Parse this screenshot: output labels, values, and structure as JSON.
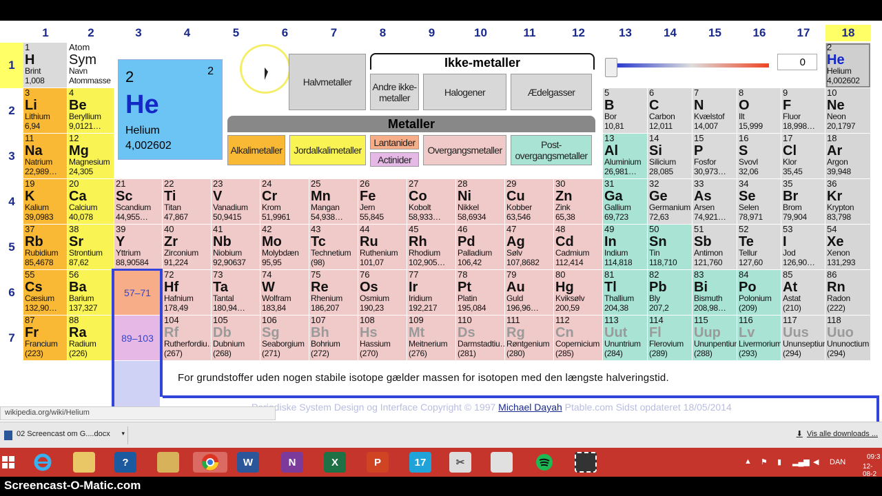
{
  "groups": [
    "1",
    "2",
    "3",
    "4",
    "5",
    "6",
    "7",
    "8",
    "9",
    "10",
    "11",
    "12",
    "13",
    "14",
    "15",
    "16",
    "17",
    "18"
  ],
  "periods": [
    "1",
    "2",
    "3",
    "4",
    "5",
    "6",
    "7"
  ],
  "legend": {
    "key": {
      "z": "Atom",
      "s": "Sym",
      "n": "Navn",
      "m": "Atommasse"
    },
    "halvmetaller": "Halvmetaller",
    "ikke_metaller": "Ikke-metaller",
    "andre": "Andre ikke-metaller",
    "halogener": "Halogener",
    "aedelgasser": "Ædelgasser",
    "metaller": "Metaller",
    "alkalimetaller": "Alkalimetaller",
    "jordalkalimetaller": "Jordalkalimetaller",
    "lantanider": "Lantanider",
    "actinider": "Actinider",
    "overgangsmetaller": "Overgangsmetaller",
    "post": "Post-overgangsmetaller"
  },
  "slider_value": "0",
  "detail": {
    "z": "2",
    "s": "He",
    "n": "Helium",
    "m": "4,002602",
    "shells": "2"
  },
  "elements": [
    {
      "z": "1",
      "s": "H",
      "n": "Brint",
      "m": "1,008",
      "c": "non",
      "r": 1,
      "g": 1
    },
    {
      "z": "2",
      "s": "He",
      "n": "Helium",
      "m": "4,002602",
      "c": "no",
      "r": 1,
      "g": 18
    },
    {
      "z": "3",
      "s": "Li",
      "n": "Lithium",
      "m": "6,94",
      "c": "alk",
      "r": 2,
      "g": 1
    },
    {
      "z": "4",
      "s": "Be",
      "n": "Beryllium",
      "m": "9,0121…",
      "c": "ear",
      "r": 2,
      "g": 2
    },
    {
      "z": "5",
      "s": "B",
      "n": "Bor",
      "m": "10,81",
      "c": "non",
      "r": 2,
      "g": 13
    },
    {
      "z": "6",
      "s": "C",
      "n": "Carbon",
      "m": "12,011",
      "c": "non",
      "r": 2,
      "g": 14
    },
    {
      "z": "7",
      "s": "N",
      "n": "Kvælstof",
      "m": "14,007",
      "c": "non",
      "r": 2,
      "g": 15
    },
    {
      "z": "8",
      "s": "O",
      "n": "Ilt",
      "m": "15,999",
      "c": "non",
      "r": 2,
      "g": 16
    },
    {
      "z": "9",
      "s": "F",
      "n": "Fluor",
      "m": "18,998…",
      "c": "non",
      "r": 2,
      "g": 17
    },
    {
      "z": "10",
      "s": "Ne",
      "n": "Neon",
      "m": "20,1797",
      "c": "no",
      "r": 2,
      "g": 18
    },
    {
      "z": "11",
      "s": "Na",
      "n": "Natrium",
      "m": "22,989…",
      "c": "alk",
      "r": 3,
      "g": 1
    },
    {
      "z": "12",
      "s": "Mg",
      "n": "Magnesium",
      "m": "24,305",
      "c": "ear",
      "r": 3,
      "g": 2
    },
    {
      "z": "13",
      "s": "Al",
      "n": "Aluminium",
      "m": "26,981…",
      "c": "pst",
      "r": 3,
      "g": 13
    },
    {
      "z": "14",
      "s": "Si",
      "n": "Silicium",
      "m": "28,085",
      "c": "non",
      "r": 3,
      "g": 14
    },
    {
      "z": "15",
      "s": "P",
      "n": "Fosfor",
      "m": "30,973…",
      "c": "non",
      "r": 3,
      "g": 15
    },
    {
      "z": "16",
      "s": "S",
      "n": "Svovl",
      "m": "32,06",
      "c": "non",
      "r": 3,
      "g": 16
    },
    {
      "z": "17",
      "s": "Cl",
      "n": "Klor",
      "m": "35,45",
      "c": "non",
      "r": 3,
      "g": 17
    },
    {
      "z": "18",
      "s": "Ar",
      "n": "Argon",
      "m": "39,948",
      "c": "no",
      "r": 3,
      "g": 18
    },
    {
      "z": "19",
      "s": "K",
      "n": "Kalium",
      "m": "39,0983",
      "c": "alk",
      "r": 4,
      "g": 1
    },
    {
      "z": "20",
      "s": "Ca",
      "n": "Calcium",
      "m": "40,078",
      "c": "ear",
      "r": 4,
      "g": 2
    },
    {
      "z": "21",
      "s": "Sc",
      "n": "Scandium",
      "m": "44,955…",
      "c": "tra",
      "r": 4,
      "g": 3
    },
    {
      "z": "22",
      "s": "Ti",
      "n": "Titan",
      "m": "47,867",
      "c": "tra",
      "r": 4,
      "g": 4
    },
    {
      "z": "23",
      "s": "V",
      "n": "Vanadium",
      "m": "50,9415",
      "c": "tra",
      "r": 4,
      "g": 5
    },
    {
      "z": "24",
      "s": "Cr",
      "n": "Krom",
      "m": "51,9961",
      "c": "tra",
      "r": 4,
      "g": 6
    },
    {
      "z": "25",
      "s": "Mn",
      "n": "Mangan",
      "m": "54,938…",
      "c": "tra",
      "r": 4,
      "g": 7
    },
    {
      "z": "26",
      "s": "Fe",
      "n": "Jern",
      "m": "55,845",
      "c": "tra",
      "r": 4,
      "g": 8
    },
    {
      "z": "27",
      "s": "Co",
      "n": "Kobolt",
      "m": "58,933…",
      "c": "tra",
      "r": 4,
      "g": 9
    },
    {
      "z": "28",
      "s": "Ni",
      "n": "Nikkel",
      "m": "58,6934",
      "c": "tra",
      "r": 4,
      "g": 10
    },
    {
      "z": "29",
      "s": "Cu",
      "n": "Kobber",
      "m": "63,546",
      "c": "tra",
      "r": 4,
      "g": 11
    },
    {
      "z": "30",
      "s": "Zn",
      "n": "Zink",
      "m": "65,38",
      "c": "tra",
      "r": 4,
      "g": 12
    },
    {
      "z": "31",
      "s": "Ga",
      "n": "Gallium",
      "m": "69,723",
      "c": "pst",
      "r": 4,
      "g": 13
    },
    {
      "z": "32",
      "s": "Ge",
      "n": "Germanium",
      "m": "72,63",
      "c": "hal",
      "r": 4,
      "g": 14
    },
    {
      "z": "33",
      "s": "As",
      "n": "Arsen",
      "m": "74,921…",
      "c": "hal",
      "r": 4,
      "g": 15
    },
    {
      "z": "34",
      "s": "Se",
      "n": "Selen",
      "m": "78,971",
      "c": "non",
      "r": 4,
      "g": 16
    },
    {
      "z": "35",
      "s": "Br",
      "n": "Brom",
      "m": "79,904",
      "c": "non",
      "r": 4,
      "g": 17
    },
    {
      "z": "36",
      "s": "Kr",
      "n": "Krypton",
      "m": "83,798",
      "c": "no",
      "r": 4,
      "g": 18
    },
    {
      "z": "37",
      "s": "Rb",
      "n": "Rubidium",
      "m": "85,4678",
      "c": "alk",
      "r": 5,
      "g": 1
    },
    {
      "z": "38",
      "s": "Sr",
      "n": "Strontium",
      "m": "87,62",
      "c": "ear",
      "r": 5,
      "g": 2
    },
    {
      "z": "39",
      "s": "Y",
      "n": "Yttrium",
      "m": "88,90584",
      "c": "tra",
      "r": 5,
      "g": 3
    },
    {
      "z": "40",
      "s": "Zr",
      "n": "Zirconium",
      "m": "91,224",
      "c": "tra",
      "r": 5,
      "g": 4
    },
    {
      "z": "41",
      "s": "Nb",
      "n": "Niobium",
      "m": "92,90637",
      "c": "tra",
      "r": 5,
      "g": 5
    },
    {
      "z": "42",
      "s": "Mo",
      "n": "Molybdæn",
      "m": "95,95",
      "c": "tra",
      "r": 5,
      "g": 6
    },
    {
      "z": "43",
      "s": "Tc",
      "n": "Technetium",
      "m": "(98)",
      "c": "tra",
      "r": 5,
      "g": 7
    },
    {
      "z": "44",
      "s": "Ru",
      "n": "Ruthenium",
      "m": "101,07",
      "c": "tra",
      "r": 5,
      "g": 8
    },
    {
      "z": "45",
      "s": "Rh",
      "n": "Rhodium",
      "m": "102,905…",
      "c": "tra",
      "r": 5,
      "g": 9
    },
    {
      "z": "46",
      "s": "Pd",
      "n": "Palladium",
      "m": "106,42",
      "c": "tra",
      "r": 5,
      "g": 10
    },
    {
      "z": "47",
      "s": "Ag",
      "n": "Sølv",
      "m": "107,8682",
      "c": "tra",
      "r": 5,
      "g": 11
    },
    {
      "z": "48",
      "s": "Cd",
      "n": "Cadmium",
      "m": "112,414",
      "c": "tra",
      "r": 5,
      "g": 12
    },
    {
      "z": "49",
      "s": "In",
      "n": "Indium",
      "m": "114,818",
      "c": "pst",
      "r": 5,
      "g": 13
    },
    {
      "z": "50",
      "s": "Sn",
      "n": "Tin",
      "m": "118,710",
      "c": "pst",
      "r": 5,
      "g": 14
    },
    {
      "z": "51",
      "s": "Sb",
      "n": "Antimon",
      "m": "121,760",
      "c": "hal",
      "r": 5,
      "g": 15
    },
    {
      "z": "52",
      "s": "Te",
      "n": "Tellur",
      "m": "127,60",
      "c": "hal",
      "r": 5,
      "g": 16
    },
    {
      "z": "53",
      "s": "I",
      "n": "Jod",
      "m": "126,90…",
      "c": "non",
      "r": 5,
      "g": 17
    },
    {
      "z": "54",
      "s": "Xe",
      "n": "Xenon",
      "m": "131,293",
      "c": "no",
      "r": 5,
      "g": 18
    },
    {
      "z": "55",
      "s": "Cs",
      "n": "Cæsium",
      "m": "132,90…",
      "c": "alk",
      "r": 6,
      "g": 1
    },
    {
      "z": "56",
      "s": "Ba",
      "n": "Barium",
      "m": "137,327",
      "c": "ear",
      "r": 6,
      "g": 2
    },
    {
      "z": "72",
      "s": "Hf",
      "n": "Hafnium",
      "m": "178,49",
      "c": "tra",
      "r": 6,
      "g": 4
    },
    {
      "z": "73",
      "s": "Ta",
      "n": "Tantal",
      "m": "180,94…",
      "c": "tra",
      "r": 6,
      "g": 5
    },
    {
      "z": "74",
      "s": "W",
      "n": "Wolfram",
      "m": "183,84",
      "c": "tra",
      "r": 6,
      "g": 6
    },
    {
      "z": "75",
      "s": "Re",
      "n": "Rhenium",
      "m": "186,207",
      "c": "tra",
      "r": 6,
      "g": 7
    },
    {
      "z": "76",
      "s": "Os",
      "n": "Osmium",
      "m": "190,23",
      "c": "tra",
      "r": 6,
      "g": 8
    },
    {
      "z": "77",
      "s": "Ir",
      "n": "Iridium",
      "m": "192,217",
      "c": "tra",
      "r": 6,
      "g": 9
    },
    {
      "z": "78",
      "s": "Pt",
      "n": "Platin",
      "m": "195,084",
      "c": "tra",
      "r": 6,
      "g": 10
    },
    {
      "z": "79",
      "s": "Au",
      "n": "Guld",
      "m": "196,96…",
      "c": "tra",
      "r": 6,
      "g": 11
    },
    {
      "z": "80",
      "s": "Hg",
      "n": "Kviksølv",
      "m": "200,59",
      "c": "tra",
      "r": 6,
      "g": 12
    },
    {
      "z": "81",
      "s": "Tl",
      "n": "Thallium",
      "m": "204,38",
      "c": "pst",
      "r": 6,
      "g": 13
    },
    {
      "z": "82",
      "s": "Pb",
      "n": "Bly",
      "m": "207,2",
      "c": "pst",
      "r": 6,
      "g": 14
    },
    {
      "z": "83",
      "s": "Bi",
      "n": "Bismuth",
      "m": "208,98…",
      "c": "pst",
      "r": 6,
      "g": 15
    },
    {
      "z": "84",
      "s": "Po",
      "n": "Polonium",
      "m": "(209)",
      "c": "pst",
      "r": 6,
      "g": 16
    },
    {
      "z": "85",
      "s": "At",
      "n": "Astat",
      "m": "(210)",
      "c": "hal",
      "r": 6,
      "g": 17
    },
    {
      "z": "86",
      "s": "Rn",
      "n": "Radon",
      "m": "(222)",
      "c": "no",
      "r": 6,
      "g": 18
    },
    {
      "z": "87",
      "s": "Fr",
      "n": "Francium",
      "m": "(223)",
      "c": "alk",
      "r": 7,
      "g": 1
    },
    {
      "z": "88",
      "s": "Ra",
      "n": "Radium",
      "m": "(226)",
      "c": "ear",
      "r": 7,
      "g": 2
    },
    {
      "z": "104",
      "s": "Rf",
      "n": "Rutherfordiu…",
      "m": "(267)",
      "c": "tra synth",
      "r": 7,
      "g": 4
    },
    {
      "z": "105",
      "s": "Db",
      "n": "Dubnium",
      "m": "(268)",
      "c": "tra synth",
      "r": 7,
      "g": 5
    },
    {
      "z": "106",
      "s": "Sg",
      "n": "Seaborgium",
      "m": "(271)",
      "c": "tra synth",
      "r": 7,
      "g": 6
    },
    {
      "z": "107",
      "s": "Bh",
      "n": "Bohrium",
      "m": "(272)",
      "c": "tra synth",
      "r": 7,
      "g": 7
    },
    {
      "z": "108",
      "s": "Hs",
      "n": "Hassium",
      "m": "(270)",
      "c": "tra synth",
      "r": 7,
      "g": 8
    },
    {
      "z": "109",
      "s": "Mt",
      "n": "Meitnerium",
      "m": "(276)",
      "c": "tra synth",
      "r": 7,
      "g": 9
    },
    {
      "z": "110",
      "s": "Ds",
      "n": "Darmstadtiu…",
      "m": "(281)",
      "c": "tra synth",
      "r": 7,
      "g": 10
    },
    {
      "z": "111",
      "s": "Rg",
      "n": "Røntgenium",
      "m": "(280)",
      "c": "tra synth",
      "r": 7,
      "g": 11
    },
    {
      "z": "112",
      "s": "Cn",
      "n": "Copernicium",
      "m": "(285)",
      "c": "tra synth",
      "r": 7,
      "g": 12
    },
    {
      "z": "113",
      "s": "Uut",
      "n": "Ununtrium",
      "m": "(284)",
      "c": "pst synth",
      "r": 7,
      "g": 13
    },
    {
      "z": "114",
      "s": "Fl",
      "n": "Flerovium",
      "m": "(289)",
      "c": "pst synth",
      "r": 7,
      "g": 14
    },
    {
      "z": "115",
      "s": "Uup",
      "n": "Ununpentium",
      "m": "(288)",
      "c": "pst synth",
      "r": 7,
      "g": 15
    },
    {
      "z": "116",
      "s": "Lv",
      "n": "Livermorium",
      "m": "(293)",
      "c": "pst synth",
      "r": 7,
      "g": 16
    },
    {
      "z": "117",
      "s": "Uus",
      "n": "Ununseptium",
      "m": "(294)",
      "c": "hal synth",
      "r": 7,
      "g": 17
    },
    {
      "z": "118",
      "s": "Uuo",
      "n": "Ununoctium",
      "m": "(294)",
      "c": "no synth",
      "r": 7,
      "g": 18
    }
  ],
  "lan_label": "57–71",
  "act_label": "89–103",
  "info_text": "For grundstoffer uden nogen stabile isotope gælder massen for isotopen med den længste halveringstid.",
  "footer": {
    "pre": "Periodiske System Design og Interface Copyright © 1997 ",
    "author": "Michael Dayah",
    "post": " Ptable.com Sidst opdateret 18/05/2014"
  },
  "status_url": "wikipedia.org/wiki/Helium",
  "download": {
    "file": "02 Screencast om G....docx",
    "show_all": "Vis alle downloads ..."
  },
  "tray": {
    "lang": "DAN",
    "time": "09:3",
    "date": "12-08-2"
  },
  "watermark": "Screencast-O-Matic.com"
}
